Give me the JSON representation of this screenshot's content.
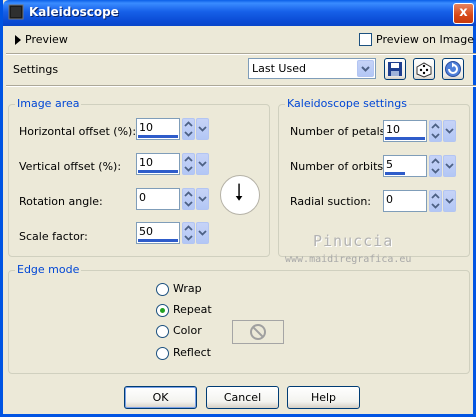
{
  "window": {
    "title": "Kaleidoscope",
    "close_glyph": "x"
  },
  "preview": {
    "toggle_label": "Preview",
    "checkbox_label": "Preview on Image"
  },
  "settings": {
    "label": "Settings",
    "preset_value": "Last Used",
    "icons": [
      "save-preset-icon",
      "randomize-icon",
      "reset-icon"
    ]
  },
  "image_area": {
    "legend": "Image area",
    "horizontal_offset": {
      "label": "Horizontal offset (%):",
      "value": "10"
    },
    "vertical_offset": {
      "label": "Vertical offset (%):",
      "value": "10"
    },
    "rotation_angle": {
      "label": "Rotation angle:",
      "value": "0"
    },
    "scale_factor": {
      "label": "Scale factor:",
      "value": "50"
    }
  },
  "kaleidoscope_settings": {
    "legend": "Kaleidoscope settings",
    "number_of_petals": {
      "label": "Number of petals:",
      "value": "10"
    },
    "number_of_orbits": {
      "label": "Number of orbits:",
      "value": "5"
    },
    "radial_suction": {
      "label": "Radial suction:",
      "value": "0"
    }
  },
  "watermark": {
    "name": "Pinuccia",
    "url": "www.maidiregrafica.eu"
  },
  "edge_mode": {
    "legend": "Edge mode",
    "options": [
      "Wrap",
      "Repeat",
      "Color",
      "Reflect"
    ],
    "selected": "Repeat"
  },
  "buttons": {
    "ok": "OK",
    "cancel": "Cancel",
    "help": "Help"
  },
  "colors": {
    "title_bar": "#0B4CD6",
    "group_legend": "#0046D5",
    "dialog_bg": "#ECE9D8",
    "selected_radio": "#21A121"
  }
}
